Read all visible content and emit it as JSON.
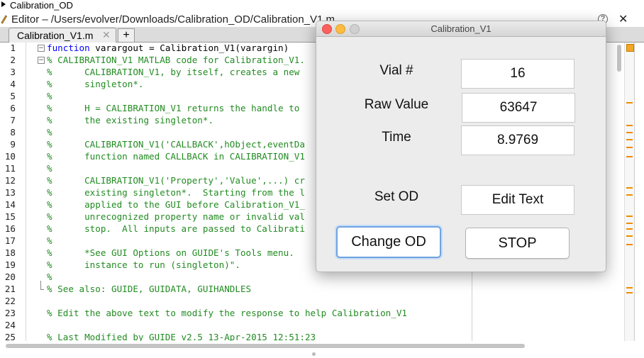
{
  "outer_title": "Calibration_OD",
  "editor": {
    "title": "Editor – /Users/evolver/Downloads/Calibration_OD/Calibration_V1.m",
    "help_glyph": "?",
    "close_glyph": "✕",
    "tab_label": "Calibration_V1.m",
    "tab_close_glyph": "✕",
    "add_tab_glyph": "+",
    "fold_glyph": "−",
    "lines": [
      {
        "n": "1",
        "fold": "box",
        "kw": "function",
        "text": " varargout = Calibration_V1(varargin)"
      },
      {
        "n": "2",
        "fold": "box",
        "cm": "% CALIBRATION_V1 MATLAB code for Calibration_V1."
      },
      {
        "n": "3",
        "cm": "%      CALIBRATION_V1, by itself, creates a new"
      },
      {
        "n": "4",
        "cm": "%      singleton*."
      },
      {
        "n": "5",
        "cm": "%"
      },
      {
        "n": "6",
        "cm": "%      H = CALIBRATION_V1 returns the handle to"
      },
      {
        "n": "7",
        "cm": "%      the existing singleton*."
      },
      {
        "n": "8",
        "cm": "%"
      },
      {
        "n": "9",
        "cm": "%      CALIBRATION_V1('CALLBACK',hObject,eventDa"
      },
      {
        "n": "10",
        "cm": "%      function named CALLBACK in CALIBRATION_V1"
      },
      {
        "n": "11",
        "cm": "%"
      },
      {
        "n": "12",
        "cm": "%      CALIBRATION_V1('Property','Value',...) cr"
      },
      {
        "n": "13",
        "cm": "%      existing singleton*.  Starting from the l"
      },
      {
        "n": "14",
        "cm": "%      applied to the GUI before Calibration_V1_"
      },
      {
        "n": "15",
        "cm": "%      unrecognized property name or invalid val"
      },
      {
        "n": "16",
        "cm": "%      stop.  All inputs are passed to Calibrati"
      },
      {
        "n": "17",
        "cm": "%"
      },
      {
        "n": "18",
        "cm": "%      *See GUI Options on GUIDE's Tools menu."
      },
      {
        "n": "19",
        "cm": "%      instance to run (singleton)\"."
      },
      {
        "n": "20",
        "cm": "%"
      },
      {
        "n": "21",
        "fold": "end",
        "cm": "% See also: GUIDE, GUIDATA, GUIHANDLES"
      },
      {
        "n": "22",
        "cm": ""
      },
      {
        "n": "23",
        "cm": "% Edit the above text to modify the response to help Calibration_V1"
      },
      {
        "n": "24",
        "cm": ""
      },
      {
        "n": "25",
        "cm": "% Last Modified by GUIDE v2.5 13-Apr-2015 12:51:23"
      }
    ]
  },
  "dialog": {
    "title": "Calibration_V1",
    "vial_label": "Vial #",
    "vial_value": "16",
    "raw_label": "Raw Value",
    "raw_value": "63647",
    "time_label": "Time",
    "time_value": "8.9769",
    "setod_label": "Set OD",
    "setod_field": "Edit Text",
    "change_od_button": "Change OD",
    "stop_button": "STOP"
  },
  "colors": {
    "keyword": "#0000ff",
    "comment": "#228b22",
    "warning_marker": "#f08c00"
  }
}
